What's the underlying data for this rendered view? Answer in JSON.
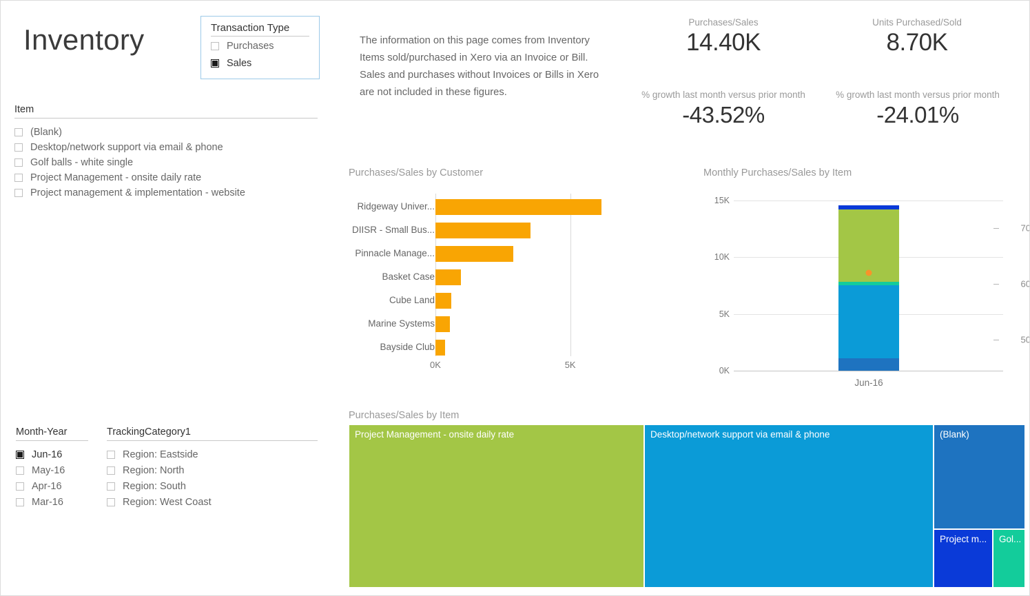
{
  "page": {
    "title": "Inventory",
    "info_text": "The information on this page comes from Inventory Items sold/purchased in Xero via an Invoice or Bill. Sales and purchases without Invoices or Bills in Xero are not included in these figures."
  },
  "slicers": {
    "transaction_type": {
      "header": "Transaction Type",
      "items": [
        {
          "label": "Purchases",
          "selected": false
        },
        {
          "label": "Sales",
          "selected": true
        }
      ]
    },
    "item": {
      "header": "Item",
      "items": [
        {
          "label": "(Blank)",
          "selected": false
        },
        {
          "label": "Desktop/network support via email & phone",
          "selected": false
        },
        {
          "label": "Golf balls - white single",
          "selected": false
        },
        {
          "label": "Project Management - onsite daily rate",
          "selected": false
        },
        {
          "label": "Project management & implementation - website",
          "selected": false
        }
      ]
    },
    "month_year": {
      "header": "Month-Year",
      "items": [
        {
          "label": "Jun-16",
          "selected": true
        },
        {
          "label": "May-16",
          "selected": false
        },
        {
          "label": "Apr-16",
          "selected": false
        },
        {
          "label": "Mar-16",
          "selected": false
        }
      ]
    },
    "tracking_category": {
      "header": "TrackingCategory1",
      "items": [
        {
          "label": "Region: Eastside",
          "selected": false
        },
        {
          "label": "Region: North",
          "selected": false
        },
        {
          "label": "Region: South",
          "selected": false
        },
        {
          "label": "Region: West Coast",
          "selected": false
        }
      ]
    }
  },
  "kpis": [
    {
      "label": "Purchases/Sales",
      "value": "14.40K"
    },
    {
      "label": "Units Purchased/Sold",
      "value": "8.70K"
    },
    {
      "label": "% growth last month versus prior month",
      "value": "-43.52%"
    },
    {
      "label": "% growth last month versus prior month",
      "value": "-24.01%"
    }
  ],
  "colors": {
    "orange": "#f9a503",
    "green": "#a3c646",
    "light_blue": "#0b9bd7",
    "medium_blue": "#1e73c0",
    "dark_blue": "#0a3ad8",
    "teal": "#13cc9b",
    "marker_orange": "#f9932a"
  },
  "chart_data": [
    {
      "type": "bar",
      "title": "Purchases/Sales by Customer",
      "orientation": "horizontal",
      "categories": [
        "Ridgeway Univer...",
        "DIISR - Small Bus...",
        "Pinnacle Manage...",
        "Basket Case",
        "Cube Land",
        "Marine Systems",
        "Bayside Club"
      ],
      "values": [
        6170,
        3530,
        2890,
        940,
        575,
        530,
        345
      ],
      "color": "#f9a503",
      "xlabel": "",
      "ylabel": "",
      "xlim": [
        0,
        6900
      ],
      "xticks": [
        0,
        5000
      ],
      "xticklabels": [
        "0K",
        "5K"
      ],
      "grid": true,
      "legend": false
    },
    {
      "type": "bar",
      "subtype": "stacked-column-with-line",
      "title": "Monthly Purchases/Sales by Item",
      "categories": [
        "Jun-16"
      ],
      "series": [
        {
          "name": "Project management & implementation - website",
          "values": [
            1100
          ],
          "color": "#1e73c0"
        },
        {
          "name": "Desktop/network support via email & phone",
          "values": [
            6450
          ],
          "color": "#0b9bd7"
        },
        {
          "name": "Golf balls - white single",
          "values": [
            290
          ],
          "color": "#13cc9b"
        },
        {
          "name": "Project Management - onsite daily rate",
          "values": [
            6340
          ],
          "color": "#a3c646"
        },
        {
          "name": "(Blank)",
          "values": [
            400
          ],
          "color": "#0a3ad8"
        }
      ],
      "line_series": {
        "name": "Units Purchased/Sold",
        "values": [
          62
        ],
        "color": "#f9932a"
      },
      "ylim": [
        0,
        15000
      ],
      "yticks": [
        0,
        5000,
        10000,
        15000
      ],
      "yticklabels": [
        "0K",
        "5K",
        "10K",
        "15K"
      ],
      "y2lim": [
        44.5,
        75
      ],
      "y2ticks": [
        50,
        60,
        70
      ],
      "y2ticklabels": [
        "50",
        "60",
        "70"
      ],
      "xticklabels": [
        "Jun-16"
      ],
      "grid": true,
      "legend": false
    },
    {
      "type": "treemap",
      "title": "Purchases/Sales by Item",
      "tiles": [
        {
          "label": "Project Management - onsite daily rate",
          "value": 6340,
          "color": "#a3c646"
        },
        {
          "label": "Desktop/network support via email & phone",
          "value": 6450,
          "color": "#0b9bd7"
        },
        {
          "label": "(Blank)",
          "value": 400,
          "color": "#1e73c0"
        },
        {
          "label": "Project m...",
          "value": 1100,
          "color": "#0a3ad8"
        },
        {
          "label": "Gol...",
          "value": 290,
          "color": "#13cc9b"
        }
      ],
      "legend": false
    }
  ]
}
